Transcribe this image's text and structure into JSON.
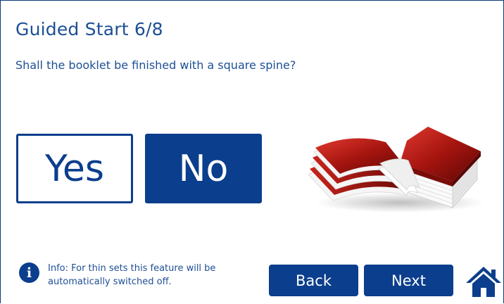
{
  "header": {
    "title": "Guided Start 6/8"
  },
  "question": "Shall the booklet be finished with a square spine?",
  "choices": {
    "yes_label": "Yes",
    "no_label": "No",
    "selected": "No"
  },
  "info": {
    "icon": "info-icon",
    "line1": "Info: For thin sets this feature will be",
    "line2": "automatically switched off."
  },
  "navigation": {
    "back_label": "Back",
    "next_label": "Next",
    "home_icon": "home-icon"
  },
  "colors": {
    "accent": "#0b3e8c",
    "text": "#1d4f94",
    "background": "#ffffff"
  }
}
